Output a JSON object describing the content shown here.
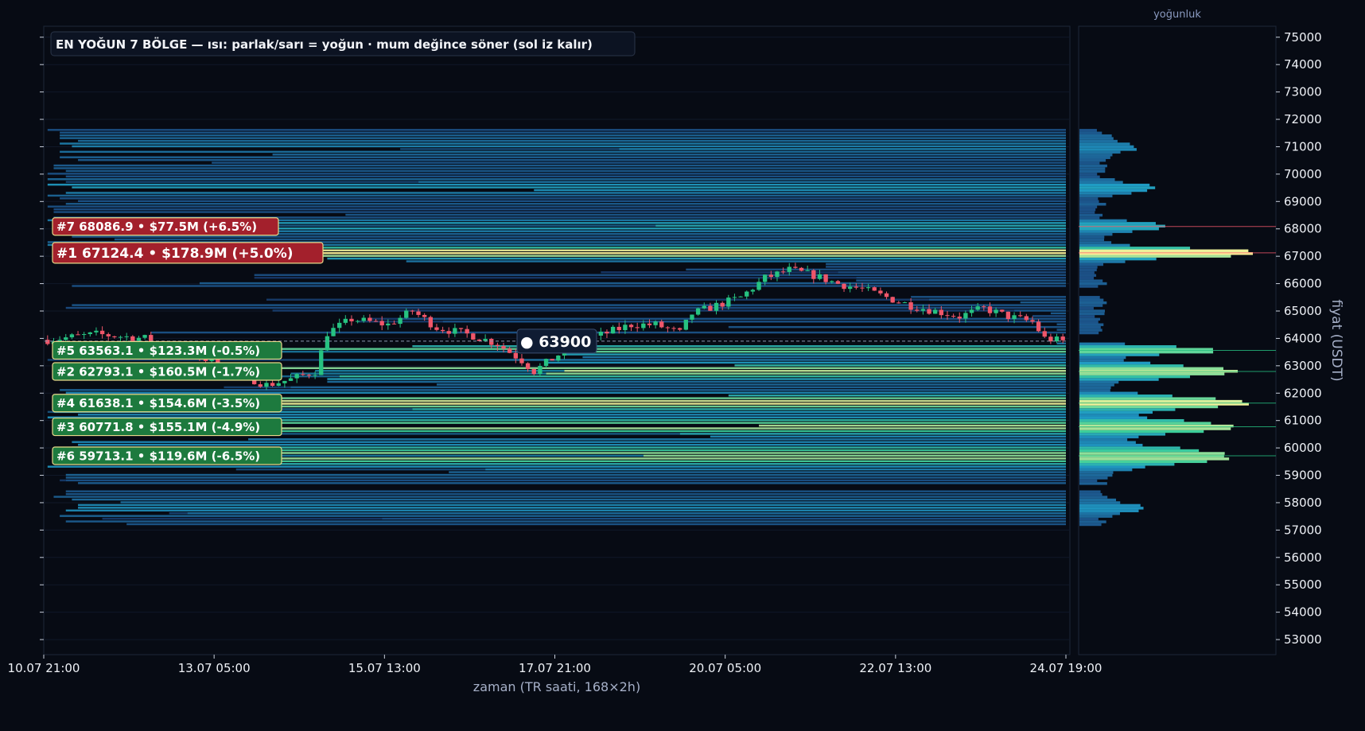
{
  "title": "EN YOĞUN 7 BÖLGE — ısı: parlak/sarı = yoğun · mum değince söner (sol iz kalır)",
  "xlabel": "zaman (TR saati, 168×2h)",
  "ylabel": "fiyat (USDT)",
  "profile_label": "yoğunluk",
  "current_price_label": "● 63900",
  "colors": {
    "background": "#070b14",
    "panel_border": "#1e2738",
    "up_candle": "#26c281",
    "down_candle": "#f0566a",
    "label_red": "#a3202c",
    "label_green": "#1d7a3e",
    "label_border": "#e8d98a",
    "heat_low": "#1b3a74",
    "heat_mid": "#1f9ac4",
    "heat_high": "#3ccf9a",
    "heat_top": "#fff59a"
  },
  "chart_data": {
    "type": "heatmap",
    "x_ticks": [
      "10.07 21:00",
      "13.07 05:00",
      "15.07 13:00",
      "17.07 21:00",
      "20.07 05:00",
      "22.07 13:00",
      "24.07 19:00"
    ],
    "y_ticks": [
      53000,
      54000,
      55000,
      56000,
      57000,
      58000,
      59000,
      60000,
      61000,
      62000,
      63000,
      64000,
      65000,
      66000,
      67000,
      68000,
      69000,
      70000,
      71000,
      72000,
      73000,
      74000,
      75000
    ],
    "ylim": [
      52450,
      75400
    ],
    "n_candles": 168,
    "current_price": 63900,
    "zones": [
      {
        "rank": 7,
        "text": "#7  68086.9  •  $77.5M  (+6.5%)",
        "price": 68086.9,
        "volume_musd": 77.5,
        "change_pct": 6.5,
        "side": "above"
      },
      {
        "rank": 1,
        "text": "#1  67124.4  •  $178.9M  (+5.0%)",
        "price": 67124.4,
        "volume_musd": 178.9,
        "change_pct": 5.0,
        "side": "above"
      },
      {
        "rank": 5,
        "text": "#5  63563.1  •  $123.3M  (-0.5%)",
        "price": 63563.1,
        "volume_musd": 123.3,
        "change_pct": -0.5,
        "side": "below"
      },
      {
        "rank": 2,
        "text": "#2  62793.1  •  $160.5M  (-1.7%)",
        "price": 62793.1,
        "volume_musd": 160.5,
        "change_pct": -1.7,
        "side": "below"
      },
      {
        "rank": 4,
        "text": "#4  61638.1  •  $154.6M  (-3.5%)",
        "price": 61638.1,
        "volume_musd": 154.6,
        "change_pct": -3.5,
        "side": "below"
      },
      {
        "rank": 3,
        "text": "#3  60771.8  •  $155.1M  (-4.9%)",
        "price": 60771.8,
        "volume_musd": 155.1,
        "change_pct": -4.9,
        "side": "below"
      },
      {
        "rank": 6,
        "text": "#6  59713.1  •  $119.6M  (-6.5%)",
        "price": 59713.1,
        "volume_musd": 119.6,
        "change_pct": -6.5,
        "side": "below"
      }
    ],
    "price_path": [
      [
        0,
        63950
      ],
      [
        8,
        64150
      ],
      [
        16,
        64000
      ],
      [
        24,
        63400
      ],
      [
        28,
        63050
      ],
      [
        32,
        62650
      ],
      [
        36,
        62300
      ],
      [
        40,
        62500
      ],
      [
        44,
        62800
      ],
      [
        46,
        64200
      ],
      [
        50,
        64700
      ],
      [
        56,
        64500
      ],
      [
        60,
        65000
      ],
      [
        64,
        64400
      ],
      [
        70,
        64100
      ],
      [
        74,
        63800
      ],
      [
        78,
        63200
      ],
      [
        80,
        62800
      ],
      [
        84,
        63400
      ],
      [
        88,
        63900
      ],
      [
        92,
        64200
      ],
      [
        96,
        64500
      ],
      [
        100,
        64500
      ],
      [
        104,
        64200
      ],
      [
        106,
        64900
      ],
      [
        110,
        65200
      ],
      [
        114,
        65500
      ],
      [
        118,
        66200
      ],
      [
        122,
        66500
      ],
      [
        126,
        66300
      ],
      [
        130,
        66000
      ],
      [
        134,
        65800
      ],
      [
        138,
        65500
      ],
      [
        142,
        65200
      ],
      [
        146,
        65000
      ],
      [
        150,
        64800
      ],
      [
        154,
        65100
      ],
      [
        158,
        64800
      ],
      [
        162,
        64600
      ],
      [
        164,
        64000
      ],
      [
        167,
        63900
      ]
    ],
    "price_volatility": 220,
    "heat_bins": {
      "min_price": 57200,
      "max_price": 71600,
      "step": 100,
      "gaps": [
        [
          58500,
          58600
        ],
        [
          63900,
          64100
        ],
        [
          65600,
          65800
        ]
      ],
      "peaks": [
        {
          "price": 57800,
          "weight": 0.25,
          "width": 250
        },
        {
          "price": 59700,
          "weight": 0.75,
          "width": 400
        },
        {
          "price": 60771.8,
          "weight": 0.8,
          "width": 300
        },
        {
          "price": 61638.1,
          "weight": 0.85,
          "width": 300
        },
        {
          "price": 62793.1,
          "weight": 0.8,
          "width": 300
        },
        {
          "price": 63563.1,
          "weight": 0.7,
          "width": 200
        },
        {
          "price": 67124.4,
          "weight": 1.0,
          "width": 220
        },
        {
          "price": 68086.9,
          "weight": 0.4,
          "width": 200
        },
        {
          "price": 69500,
          "weight": 0.3,
          "width": 250
        },
        {
          "price": 71000,
          "weight": 0.2,
          "width": 300
        }
      ]
    }
  }
}
